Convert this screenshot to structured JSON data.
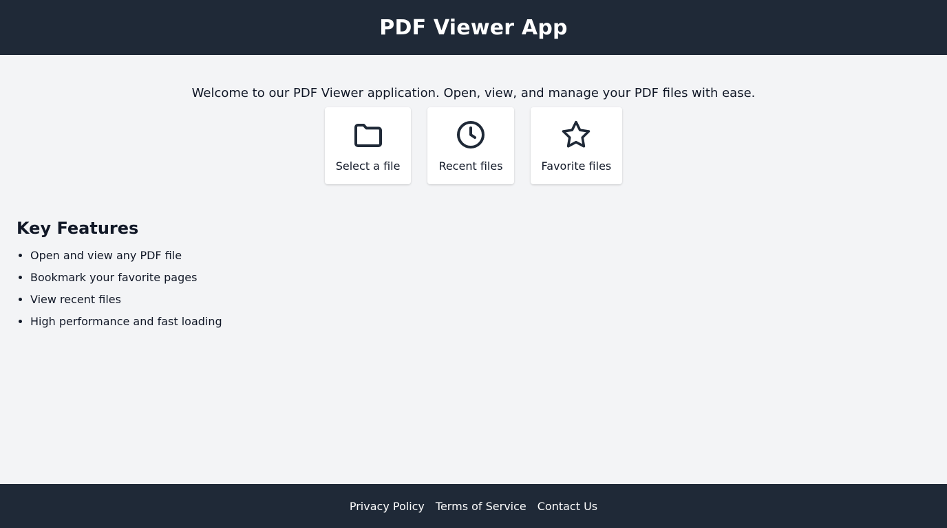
{
  "header": {
    "title": "PDF Viewer App"
  },
  "welcome": {
    "text": "Welcome to our PDF Viewer application. Open, view, and manage your PDF files with ease."
  },
  "actions": [
    {
      "label": "Select a file",
      "icon": "folder-icon"
    },
    {
      "label": "Recent files",
      "icon": "clock-icon"
    },
    {
      "label": "Favorite files",
      "icon": "star-icon"
    }
  ],
  "features": {
    "title": "Key Features",
    "items": [
      "Open and view any PDF file",
      "Bookmark your favorite pages",
      "View recent files",
      "High performance and fast loading"
    ]
  },
  "footer": {
    "links": [
      "Privacy Policy",
      "Terms of Service",
      "Contact Us"
    ]
  },
  "colors": {
    "header_bg": "#1f2937",
    "page_bg": "#f3f4f6",
    "icon_stroke": "#1f2937"
  }
}
